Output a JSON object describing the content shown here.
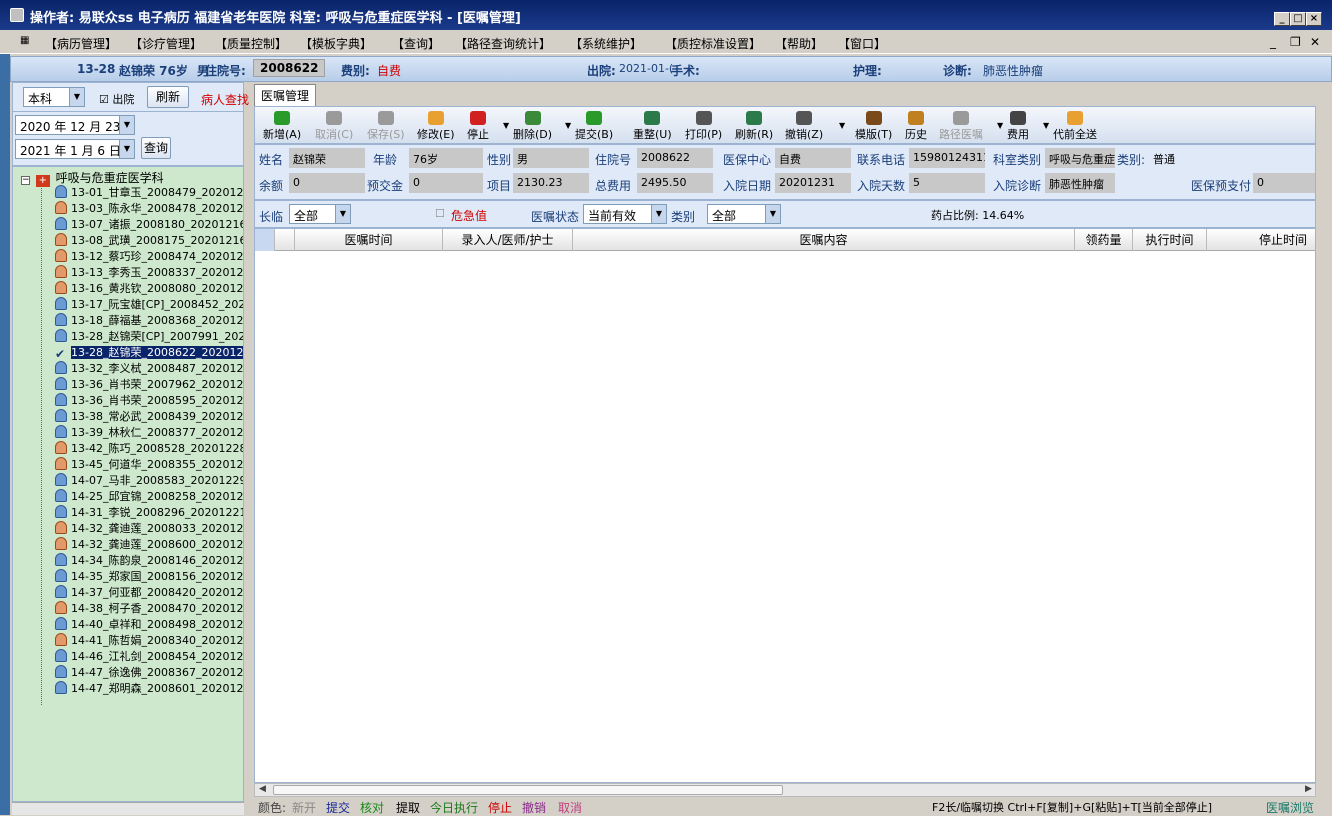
{
  "window": {
    "title": "操作者: 易联众ss 电子病历  福建省老年医院  科室: 呼吸与危重症医学科 - [医嘱管理]"
  },
  "menu": [
    "【病历管理】",
    "【诊疗管理】",
    "【质量控制】",
    "【模板字典】",
    "【查询】",
    "【路径查询统计】",
    "【系统维护】",
    "【质控标准设置】",
    "【帮助】",
    "【窗口】"
  ],
  "patient_bar": {
    "bed": "13-28",
    "name_age": "赵锦荣 76岁",
    "gender_prefix": "男",
    "inpatient_label": "住院号:",
    "inpatient_no": "2008622",
    "fee_label": "费别:",
    "fee_type": "自费",
    "discharge_label": "出院:",
    "discharge_date": "2021-01-(",
    "surgery_label": "手术:",
    "nursing_label": "护理:",
    "diagnosis_label": "诊断:",
    "diagnosis": "肺恶性肿瘤"
  },
  "left_panel": {
    "scope_select": "本科",
    "discharged_checkbox_label": "出院",
    "refresh_button": "刷新",
    "patient_query_link": "病人查找",
    "date_from": "2020 年 12 月 23",
    "date_to": "2021 年 1 月 6 日",
    "query_button": "查询"
  },
  "tree": {
    "root": "呼吸与危重症医学科",
    "items": [
      {
        "label": "13-01_甘章玉_2008479_2020122",
        "sex": "m"
      },
      {
        "label": "13-03_陈永华_2008478_2020122",
        "sex": "f"
      },
      {
        "label": "13-07_诸振_2008180_20201216",
        "sex": "m"
      },
      {
        "label": "13-08_武璜_2008175_20201216",
        "sex": "f"
      },
      {
        "label": "13-12_蔡巧珍_2008474_2020122",
        "sex": "f"
      },
      {
        "label": "13-13_李秀玉_2008337_2020122",
        "sex": "f"
      },
      {
        "label": "13-16_黄兆钦_2008080_2020121",
        "sex": "f"
      },
      {
        "label": "13-17_阮宝雄[CP]_2008452_202",
        "sex": "m"
      },
      {
        "label": "13-18_薛福基_2008368_2020122",
        "sex": "m"
      },
      {
        "label": "13-28_赵锦荣[CP]_2007991_202",
        "sex": "m"
      },
      {
        "label": "13-28_赵锦荣_2008622_2020123",
        "sex": "c",
        "selected": true
      },
      {
        "label": "13-32_李义栻_2008487_2020122",
        "sex": "m"
      },
      {
        "label": "13-36_肖书荣_2007962_2020120",
        "sex": "m"
      },
      {
        "label": "13-36_肖书荣_2008595_2020123",
        "sex": "m"
      },
      {
        "label": "13-38_常必武_2008439_2020122",
        "sex": "m"
      },
      {
        "label": "13-39_林秋仁_2008377_2020122",
        "sex": "m"
      },
      {
        "label": "13-42_陈巧_2008528_20201228",
        "sex": "f"
      },
      {
        "label": "13-45_何道华_2008355_2020122",
        "sex": "f"
      },
      {
        "label": "14-07_马非_2008583_20201229",
        "sex": "m"
      },
      {
        "label": "14-25_邱宜锦_2008258_2020121",
        "sex": "m"
      },
      {
        "label": "14-31_李锐_2008296_20201221",
        "sex": "m"
      },
      {
        "label": "14-32_龚迪莲_2008033_2020121",
        "sex": "f"
      },
      {
        "label": "14-32_龚迪莲_2008600_2020123",
        "sex": "f"
      },
      {
        "label": "14-34_陈韵泉_2008146_2020121",
        "sex": "m"
      },
      {
        "label": "14-35_郑家国_2008156_2020121",
        "sex": "m"
      },
      {
        "label": "14-37_何亚都_2008420_2020122",
        "sex": "m"
      },
      {
        "label": "14-38_柯子香_2008470_2020122",
        "sex": "f"
      },
      {
        "label": "14-40_卓祥和_2008498_2020122",
        "sex": "m"
      },
      {
        "label": "14-41_陈哲娟_2008340_2020122",
        "sex": "f"
      },
      {
        "label": "14-46_江礼剑_2008454_2020122",
        "sex": "m"
      },
      {
        "label": "14-47_徐逸佛_2008367_2020122",
        "sex": "m"
      },
      {
        "label": "14-47_郑明森_2008601_2020123",
        "sex": "m"
      }
    ]
  },
  "tab": "医嘱管理",
  "toolbar": [
    {
      "label": "新增(A)",
      "icon": "add-icon",
      "color": "#2a9a2a",
      "enabled": true
    },
    {
      "label": "取消(C)",
      "icon": "undo-icon",
      "color": "#9a9a9a",
      "enabled": false
    },
    {
      "label": "保存(S)",
      "icon": "save-icon",
      "color": "#9a9a9a",
      "enabled": false
    },
    {
      "label": "修改(E)",
      "icon": "edit-icon",
      "color": "#e8a030",
      "enabled": true
    },
    {
      "label": "停止",
      "icon": "stop-icon",
      "color": "#d02020",
      "enabled": true
    },
    {
      "label": "删除(D)",
      "icon": "delete-icon",
      "color": "#3a8a3a",
      "enabled": true
    },
    {
      "label": "提交(B)",
      "icon": "submit-icon",
      "color": "#2a9a2a",
      "enabled": true
    },
    {
      "label": "重整(U)",
      "icon": "reorder-icon",
      "color": "#2a7a4a",
      "enabled": true
    },
    {
      "label": "打印(P)",
      "icon": "print-icon",
      "color": "#555555",
      "enabled": true
    },
    {
      "label": "刷新(R)",
      "icon": "refresh-icon",
      "color": "#2a7a4a",
      "enabled": true
    },
    {
      "label": "撤销(Z)",
      "icon": "trash-icon",
      "color": "#555555",
      "enabled": true
    },
    {
      "label": "模版(T)",
      "icon": "template-icon",
      "color": "#7a4a1a",
      "enabled": true
    },
    {
      "label": "历史",
      "icon": "history-icon",
      "color": "#c08020",
      "enabled": true
    },
    {
      "label": "路径医嘱",
      "icon": "path-order-icon",
      "color": "#9a9a9a",
      "enabled": false
    },
    {
      "label": "费用",
      "icon": "calculator-icon",
      "color": "#444444",
      "enabled": true
    },
    {
      "label": "代前全送",
      "icon": "send-all-icon",
      "color": "#e8a030",
      "enabled": true
    }
  ],
  "info": {
    "name_label": "姓名",
    "name": "赵锦荣",
    "age_label": "年龄",
    "age": "76岁",
    "sex_label": "性别",
    "sex": "男",
    "inpatient_label": "住院号",
    "inpatient_no": "2008622",
    "insurance_label": "医保中心",
    "insurance": "自费",
    "phone_label": "联系电话",
    "phone": "15980124311",
    "dept_type_label": "科室类别",
    "dept_type": "呼吸与危重症",
    "category_label": "类别:",
    "category": "普通",
    "balance_label": "余额",
    "balance": "0",
    "deposit_label": "预交金",
    "deposit": "0",
    "item_label": "项目",
    "item": "2130.23",
    "total_label": "总费用",
    "total": "2495.50",
    "admit_date_label": "入院日期",
    "admit_date": "20201231",
    "days_label": "入院天数",
    "days": "5",
    "admit_diag_label": "入院诊断",
    "admit_diag": "肺恶性肿瘤",
    "prepay_label": "医保预支付",
    "prepay": "0"
  },
  "filters": {
    "longterm_label": "长临",
    "longterm": "全部",
    "critical_label": "危急值",
    "status_label": "医嘱状态",
    "status": "当前有效",
    "type_label": "类别",
    "type": "全部",
    "drug_ratio": "药占比例: 14.64%"
  },
  "grid_columns": [
    "医嘱时间",
    "录入人/医师/护士",
    "医嘱内容",
    "领药量",
    "执行时间",
    "停止时间"
  ],
  "status_bar": {
    "color_label": "颜色:",
    "legend": [
      {
        "label": "新开",
        "color": "#8a8a8a"
      },
      {
        "label": "提交",
        "color": "#1a2a9a"
      },
      {
        "label": "核对",
        "color": "#1a8a1a"
      },
      {
        "label": "提取",
        "color": "#000000"
      },
      {
        "label": "今日执行",
        "color": "#1a7a1a"
      },
      {
        "label": "停止",
        "color": "#d00000"
      },
      {
        "label": "撤销",
        "color": "#8a2a8a"
      },
      {
        "label": "取消",
        "color": "#c04080"
      }
    ],
    "shortcut_hint": "F2长/临嘱切换 Ctrl+F[复制]+G[粘贴]+T[当前全部停止]",
    "mode": "医嘱浏览"
  }
}
